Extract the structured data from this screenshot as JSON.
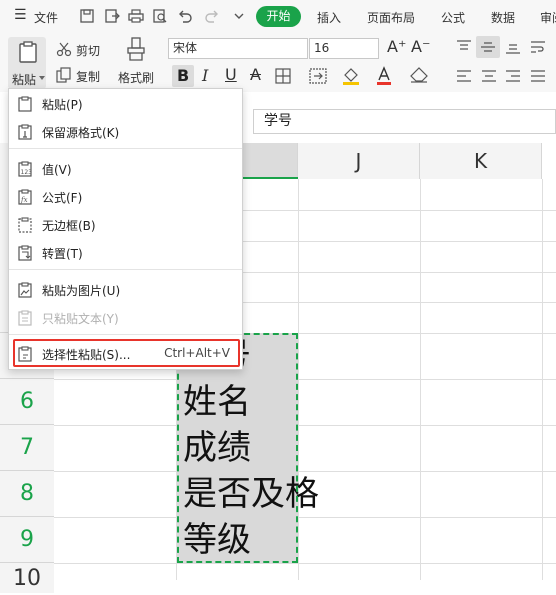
{
  "menu_bar": {
    "menu_label": "文件",
    "tabs": [
      "开始",
      "插入",
      "页面布局",
      "公式",
      "数据",
      "审阅"
    ]
  },
  "ribbon": {
    "paste_label": "粘贴",
    "cut_label": "剪切",
    "copy_label": "复制",
    "format_painter_label": "格式刷",
    "font_name": "宋体",
    "font_size": "16"
  },
  "formula_bar": {
    "content": "学号"
  },
  "columns": [
    "J",
    "K"
  ],
  "rows": [
    "6",
    "7",
    "8",
    "9",
    "10"
  ],
  "cells": [
    "学号",
    "姓名",
    "成绩",
    "是否及格",
    "等级"
  ],
  "paste_menu": {
    "items": [
      {
        "label": "粘贴(P)",
        "icon": "paste-icon",
        "disabled": false
      },
      {
        "label": "保留源格式(K)",
        "icon": "paste-keep-format-icon",
        "disabled": false
      },
      {
        "label": "值(V)",
        "icon": "paste-values-icon",
        "disabled": false
      },
      {
        "label": "公式(F)",
        "icon": "paste-formula-icon",
        "disabled": false
      },
      {
        "label": "无边框(B)",
        "icon": "paste-no-border-icon",
        "disabled": false
      },
      {
        "label": "转置(T)",
        "icon": "transpose-icon",
        "disabled": false
      },
      {
        "label": "粘贴为图片(U)",
        "icon": "paste-picture-icon",
        "disabled": false
      },
      {
        "label": "只粘贴文本(Y)",
        "icon": "paste-text-icon",
        "disabled": true
      },
      {
        "label": "选择性粘贴(S)...",
        "icon": "paste-special-icon",
        "disabled": false,
        "shortcut": "Ctrl+Alt+V"
      }
    ]
  },
  "colors": {
    "accent": "#1aa34a",
    "highlight": "#e8342b"
  }
}
